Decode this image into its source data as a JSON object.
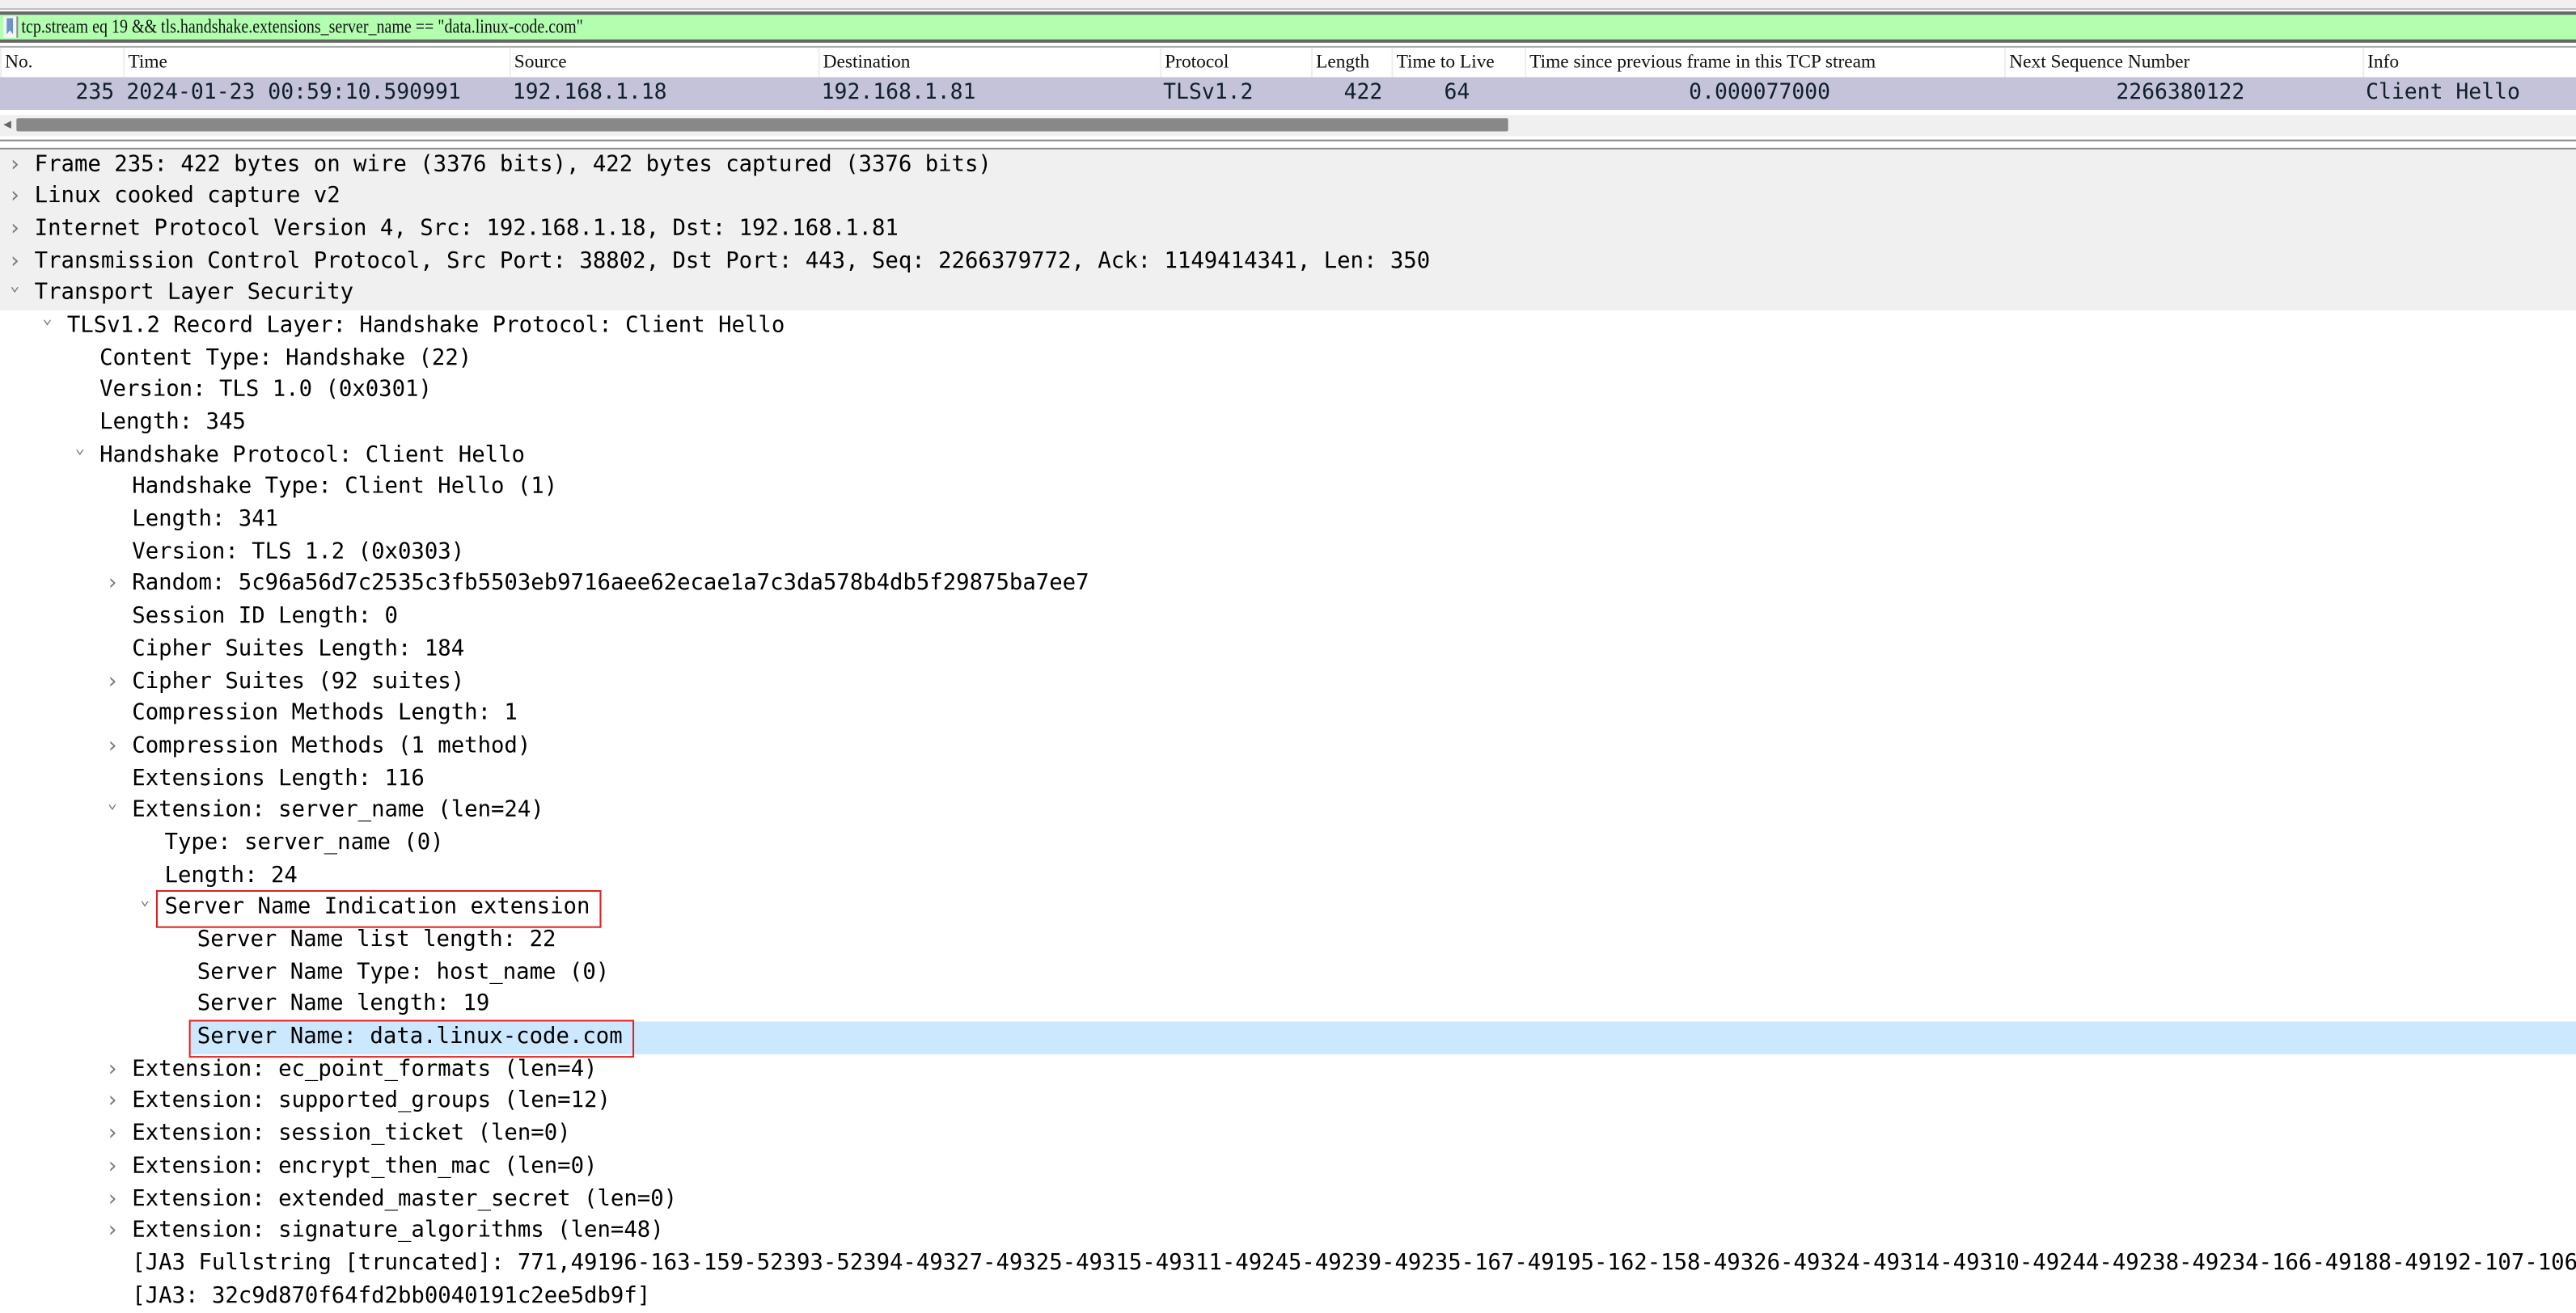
{
  "filter": {
    "value": "tcp.stream eq 19 && tls.handshake.extensions_server_name == \"data.linux-code.com\"",
    "icon": "bookmark-icon",
    "bg_color": "#b3ffb0"
  },
  "packet_list": {
    "columns": [
      "No.",
      "Time",
      "Source",
      "Destination",
      "Protocol",
      "Length",
      "Time to Live",
      "Time since previous frame in this TCP stream",
      "Next Sequence Number",
      "Info"
    ],
    "rows": [
      [
        "235",
        "2024-01-23 00:59:10.590991",
        "192.168.1.18",
        "192.168.1.81",
        "TLSv1.2",
        "422",
        "64",
        "0.000077000",
        "2266380122",
        "Client Hello"
      ]
    ],
    "selected_row_color": "#c5c3d9"
  },
  "tree": [
    {
      "level": 0,
      "state": "collapsed",
      "text": "Frame 235: 422 bytes on wire (3376 bits), 422 bytes captured (3376 bits)"
    },
    {
      "level": 0,
      "state": "collapsed",
      "text": "Linux cooked capture v2"
    },
    {
      "level": 0,
      "state": "collapsed",
      "text": "Internet Protocol Version 4, Src: 192.168.1.18, Dst: 192.168.1.81"
    },
    {
      "level": 0,
      "state": "collapsed",
      "text": "Transmission Control Protocol, Src Port: 38802, Dst Port: 443, Seq: 2266379772, Ack: 1149414341, Len: 350"
    },
    {
      "level": 0,
      "state": "expanded",
      "text": "Transport Layer Security"
    },
    {
      "level": 1,
      "state": "expanded",
      "text": "TLSv1.2 Record Layer: Handshake Protocol: Client Hello"
    },
    {
      "level": 2,
      "state": "none",
      "text": "Content Type: Handshake (22)"
    },
    {
      "level": 2,
      "state": "none",
      "text": "Version: TLS 1.0 (0x0301)"
    },
    {
      "level": 2,
      "state": "none",
      "text": "Length: 345"
    },
    {
      "level": 2,
      "state": "expanded",
      "text": "Handshake Protocol: Client Hello"
    },
    {
      "level": 3,
      "state": "none",
      "text": "Handshake Type: Client Hello (1)"
    },
    {
      "level": 3,
      "state": "none",
      "text": "Length: 341"
    },
    {
      "level": 3,
      "state": "none",
      "text": "Version: TLS 1.2 (0x0303)"
    },
    {
      "level": 3,
      "state": "collapsed",
      "text": "Random: 5c96a56d7c2535c3fb5503eb9716aee62ecae1a7c3da578b4db5f29875ba7ee7"
    },
    {
      "level": 3,
      "state": "none",
      "text": "Session ID Length: 0"
    },
    {
      "level": 3,
      "state": "none",
      "text": "Cipher Suites Length: 184"
    },
    {
      "level": 3,
      "state": "collapsed",
      "text": "Cipher Suites (92 suites)"
    },
    {
      "level": 3,
      "state": "none",
      "text": "Compression Methods Length: 1"
    },
    {
      "level": 3,
      "state": "collapsed",
      "text": "Compression Methods (1 method)"
    },
    {
      "level": 3,
      "state": "none",
      "text": "Extensions Length: 116"
    },
    {
      "level": 3,
      "state": "expanded",
      "text": "Extension: server_name (len=24)"
    },
    {
      "level": 4,
      "state": "none",
      "text": "Type: server_name (0)"
    },
    {
      "level": 4,
      "state": "none",
      "text": "Length: 24"
    },
    {
      "level": 4,
      "state": "expanded",
      "text": "Server Name Indication extension",
      "highlighted": true
    },
    {
      "level": 5,
      "state": "none",
      "text": "Server Name list length: 22"
    },
    {
      "level": 5,
      "state": "none",
      "text": "Server Name Type: host_name (0)"
    },
    {
      "level": 5,
      "state": "none",
      "text": "Server Name length: 19"
    },
    {
      "level": 5,
      "state": "none",
      "text": "Server Name: data.linux-code.com",
      "selected": true,
      "highlighted": true
    },
    {
      "level": 3,
      "state": "collapsed",
      "text": "Extension: ec_point_formats (len=4)"
    },
    {
      "level": 3,
      "state": "collapsed",
      "text": "Extension: supported_groups (len=12)"
    },
    {
      "level": 3,
      "state": "collapsed",
      "text": "Extension: session_ticket (len=0)"
    },
    {
      "level": 3,
      "state": "collapsed",
      "text": "Extension: encrypt_then_mac (len=0)"
    },
    {
      "level": 3,
      "state": "collapsed",
      "text": "Extension: extended_master_secret (len=0)"
    },
    {
      "level": 3,
      "state": "collapsed",
      "text": "Extension: signature_algorithms (len=48)"
    },
    {
      "level": 3,
      "state": "none",
      "text": "[JA3 Fullstring [truncated]: 771,49196-163-159-52393-52394-49327-49325-49315-49311-49245-49239-49235-167-49195-162-158-49326-49324-49314-49310-49244-49238-49234-166-49188-49192-107-106"
    },
    {
      "level": 3,
      "state": "none",
      "text": "[JA3: 32c9d870f64fd2bb0040191c2ee5db9f]"
    }
  ],
  "colors": {
    "selected_tree_row": "#cce8ff",
    "highlight_box": "#e02020",
    "top_level_row_bg": "#f0f0f0"
  }
}
